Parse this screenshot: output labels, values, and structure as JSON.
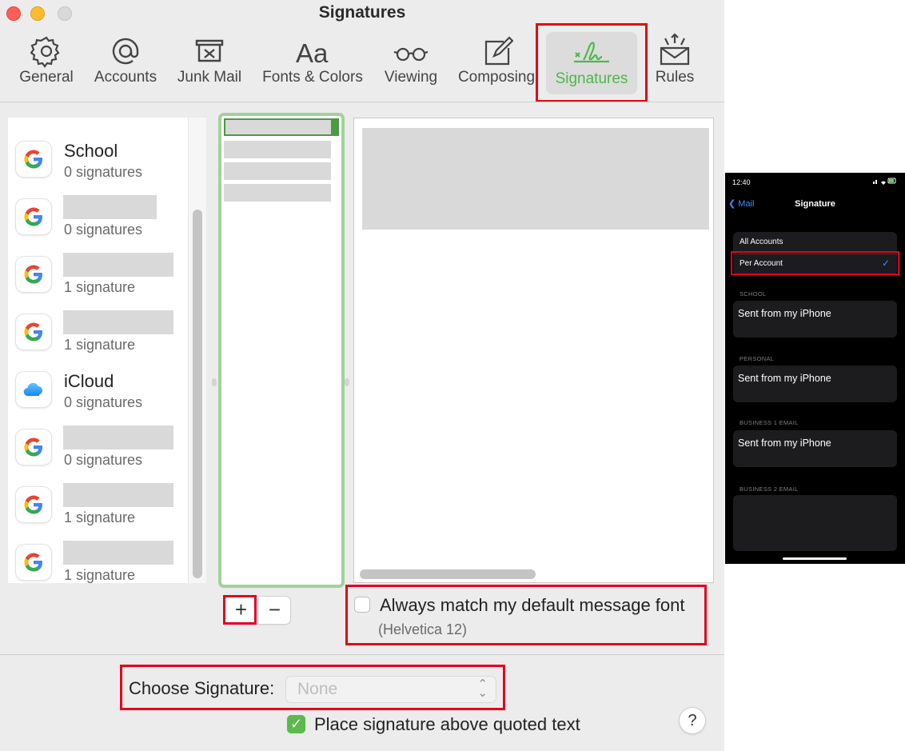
{
  "window": {
    "title": "Signatures"
  },
  "toolbar": {
    "items": [
      {
        "label": "General",
        "icon": "gear-icon"
      },
      {
        "label": "Accounts",
        "icon": "at-icon"
      },
      {
        "label": "Junk Mail",
        "icon": "junk-tray-icon"
      },
      {
        "label": "Fonts & Colors",
        "icon": "aa-text-icon"
      },
      {
        "label": "Viewing",
        "icon": "glasses-icon"
      },
      {
        "label": "Composing",
        "icon": "compose-icon"
      },
      {
        "label": "Signatures",
        "icon": "signature-icon",
        "selected": true
      },
      {
        "label": "Rules",
        "icon": "envelope-rules-icon"
      }
    ]
  },
  "accounts": [
    {
      "name": "School",
      "count": "0 signatures",
      "icon": "google-icon"
    },
    {
      "name": "",
      "count": "0 signatures",
      "icon": "google-icon"
    },
    {
      "name": "",
      "count": "1 signature",
      "icon": "google-icon"
    },
    {
      "name": "",
      "count": "1 signature",
      "icon": "google-icon"
    },
    {
      "name": "iCloud",
      "count": "0 signatures",
      "icon": "icloud-icon"
    },
    {
      "name": "",
      "count": "0 signatures",
      "icon": "google-icon"
    },
    {
      "name": "",
      "count": "1 signature",
      "icon": "google-icon"
    },
    {
      "name": "",
      "count": "1 signature",
      "icon": "google-icon"
    }
  ],
  "buttons": {
    "add": "+",
    "remove": "−",
    "help": "?"
  },
  "font_option": {
    "label": "Always match my default message font",
    "hint": "(Helvetica 12)",
    "checked": false
  },
  "choose_signature": {
    "label": "Choose Signature:",
    "value": "None"
  },
  "place_above": {
    "label": "Place signature above quoted text",
    "checked": true
  },
  "colors": {
    "accent_green": "#4cb84a",
    "highlight_red": "#e3001b",
    "ios_blue": "#3d8cff"
  },
  "phone": {
    "time": "12:40",
    "back": "Mail",
    "title": "Signature",
    "options": [
      "All Accounts",
      "Per Account"
    ],
    "selected": "Per Account",
    "sections": [
      {
        "header": "SCHOOL",
        "text": "Sent from my iPhone"
      },
      {
        "header": "PERSONAL",
        "text": "Sent from my iPhone"
      },
      {
        "header": "BUSINESS 1 EMAIL",
        "text": "Sent from my iPhone"
      },
      {
        "header": "BUSINESS 2 EMAIL",
        "text": ""
      }
    ]
  }
}
